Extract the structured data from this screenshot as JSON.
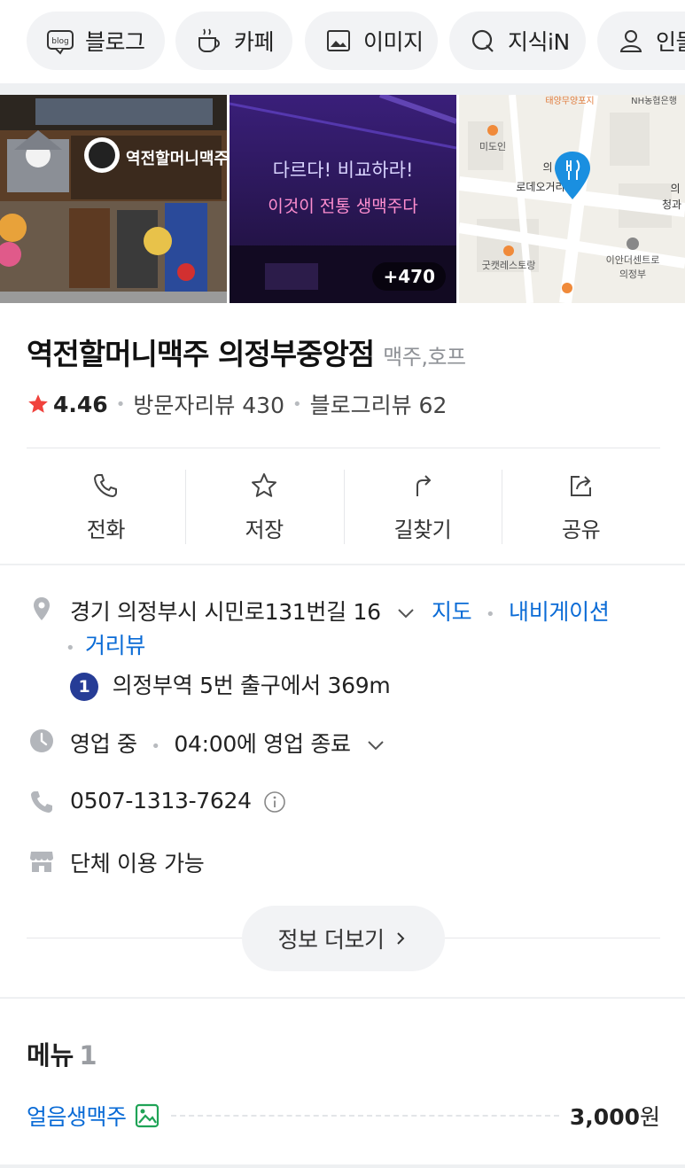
{
  "chips": [
    {
      "label": "블로그",
      "icon": "blog-icon"
    },
    {
      "label": "카페",
      "icon": "cafe-cup-icon"
    },
    {
      "label": "이미지",
      "icon": "image-icon"
    },
    {
      "label": "지식iN",
      "icon": "knowledge-in-icon"
    },
    {
      "label": "인물",
      "icon": "person-icon"
    }
  ],
  "blog_icon_text": "blog",
  "photos": {
    "storefront_sign": "역전할머니맥주",
    "neon_line1": "다르다! 비교하라!",
    "neon_line2": "이것이 전통 생맥주다",
    "more_count": "+470",
    "map_labels": [
      "태양무양포지",
      "NH농협은행",
      "미도인",
      "의",
      "로데오거리",
      "의",
      "청과",
      "굿캣레스토랑",
      "이안더센트로",
      "의정부"
    ]
  },
  "place": {
    "name": "역전할머니맥주 의정부중앙점",
    "category": "맥주,호프",
    "rating": "4.46",
    "visitor_reviews": "방문자리뷰 430",
    "blog_reviews": "블로그리뷰 62"
  },
  "actions": [
    {
      "label": "전화",
      "icon": "phone-icon"
    },
    {
      "label": "저장",
      "icon": "star-outline-icon"
    },
    {
      "label": "길찾기",
      "icon": "directions-icon"
    },
    {
      "label": "공유",
      "icon": "share-icon"
    }
  ],
  "info": {
    "address": "경기 의정부시 시민로131번길 16",
    "map_link": "지도",
    "navi_link": "내비게이션",
    "street_link": "거리뷰",
    "subway_line": "1",
    "subway_text": "의정부역 5번 출구에서 369m",
    "status": "영업 중",
    "hours": "04:00에 영업 종료",
    "phone": "0507-1313-7624",
    "facility": "단체 이용 가능",
    "more_label": "정보 더보기"
  },
  "menu": {
    "title": "메뉴",
    "count": "1",
    "items": [
      {
        "name": "얼음생맥주",
        "price": "3,000",
        "unit": "원"
      }
    ]
  },
  "colors": {
    "link": "#0a6bd6",
    "star": "#f0423c",
    "subway_line1": "#263c96",
    "map_pin": "#1a8fe0"
  }
}
